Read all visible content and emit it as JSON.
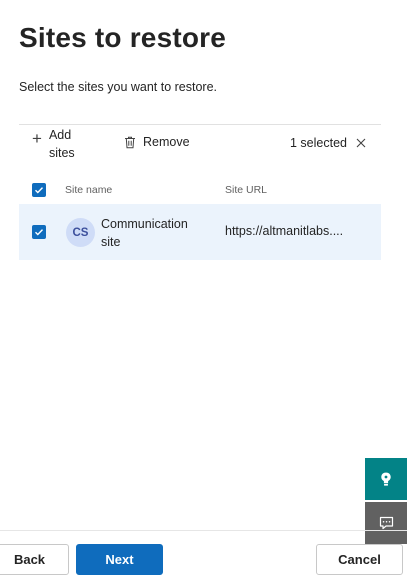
{
  "page": {
    "title": "Sites to restore",
    "subtitle": "Select the sites you want to restore."
  },
  "toolbar": {
    "add_label": "Add sites",
    "remove_label": "Remove",
    "selected_text": "1 selected",
    "plus_icon": "+",
    "trash_icon": "trash-icon",
    "clear_icon": "close-icon"
  },
  "table": {
    "columns": [
      "Site name",
      "Site URL"
    ],
    "header_checked": true,
    "rows": [
      {
        "checked": true,
        "initials": "CS",
        "name": "Communication site",
        "url": "https://altmanitlabs...."
      }
    ]
  },
  "side_buttons": {
    "help_icon": "help-icon",
    "feedback_icon": "feedback-icon"
  },
  "footer": {
    "back_label": "Back",
    "next_label": "Next",
    "cancel_label": "Cancel"
  },
  "colors": {
    "accent": "#0f6cbd",
    "row_selected": "#ebf3fc",
    "help_button": "#038387",
    "feedback_button": "#616161",
    "avatar_bg": "#cfdcf7"
  }
}
